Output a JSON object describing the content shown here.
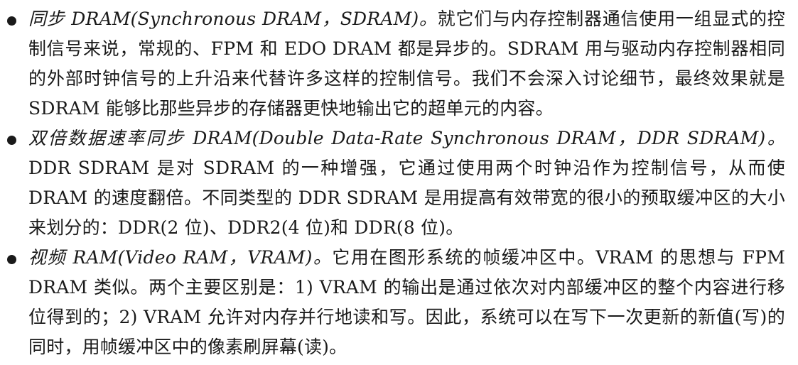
{
  "items": [
    {
      "term": "同步 DRAM(Synchronous DRAM，SDRAM)。",
      "text": "就它们与内存控制器通信使用一组显式的控制信号来说，常规的、FPM 和 EDO DRAM 都是异步的。SDRAM 用与驱动内存控制器相同的外部时钟信号的上升沿来代替许多这样的控制信号。我们不会深入讨论细节，最终效果就是 SDRAM 能够比那些异步的存储器更快地输出它的超单元的内容。"
    },
    {
      "term": "双倍数据速率同步 DRAM(Double Data-Rate Synchronous DRAM，DDR SDRAM)。",
      "text": "DDR SDRAM 是对 SDRAM 的一种增强，它通过使用两个时钟沿作为控制信号，从而使 DRAM 的速度翻倍。不同类型的 DDR SDRAM 是用提高有效带宽的很小的预取缓冲区的大小来划分的：DDR(2 位)、DDR2(4 位)和 DDR(8 位)。"
    },
    {
      "term": "视频 RAM(Video RAM，VRAM)。",
      "text": "它用在图形系统的帧缓冲区中。VRAM 的思想与 FPM DRAM 类似。两个主要区别是：1) VRAM 的输出是通过依次对内部缓冲区的整个内容进行移位得到的；2) VRAM 允许对内存并行地读和写。因此，系统可以在写下一次更新的新值(写)的同时，用帧缓冲区中的像素刷屏幕(读)。"
    }
  ]
}
